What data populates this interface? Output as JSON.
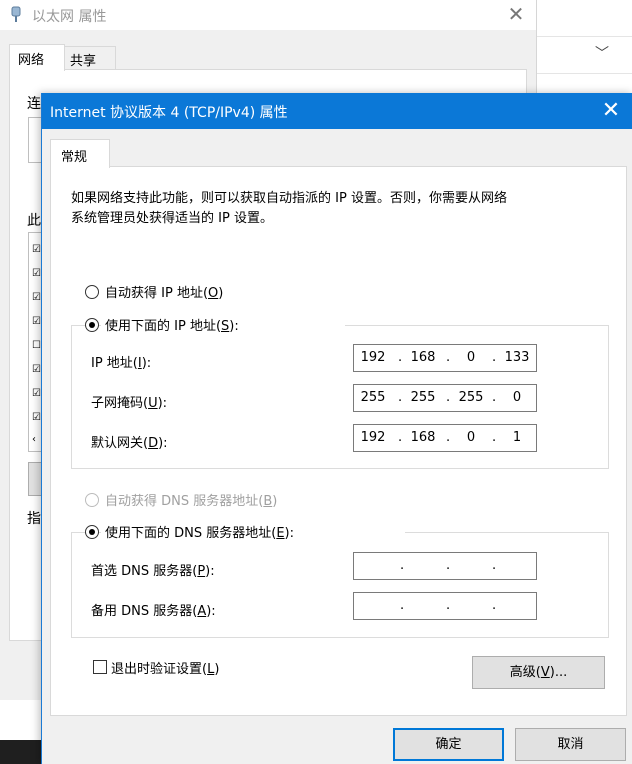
{
  "background_window": {
    "title": "以太网 属性",
    "tabs": [
      "网络",
      "共享"
    ],
    "fragments": [
      "连",
      "此",
      "指"
    ]
  },
  "dialog": {
    "title": "Internet 协议版本 4 (TCP/IPv4) 属性",
    "tab": "常规",
    "description_line1": "如果网络支持此功能，则可以获取自动指派的 IP 设置。否则，你需要从网络",
    "description_line2": "系统管理员处获得适当的 IP 设置。",
    "ip_mode": {
      "auto_label": "自动获得 IP 地址(",
      "auto_key": "O",
      "auto_tail": ")",
      "manual_label": "使用下面的 IP 地址(",
      "manual_key": "S",
      "manual_tail": "):",
      "selected": "manual"
    },
    "ip_fields": [
      {
        "label": "IP 地址(",
        "key": "I",
        "tail": "):",
        "octets": [
          "192",
          "168",
          "0",
          "133"
        ]
      },
      {
        "label": "子网掩码(",
        "key": "U",
        "tail": "):",
        "octets": [
          "255",
          "255",
          "255",
          "0"
        ]
      },
      {
        "label": "默认网关(",
        "key": "D",
        "tail": "):",
        "octets": [
          "192",
          "168",
          "0",
          "1"
        ]
      }
    ],
    "dns_mode": {
      "auto_label": "自动获得 DNS 服务器地址(",
      "auto_key": "B",
      "auto_tail": ")",
      "manual_label": "使用下面的 DNS 服务器地址(",
      "manual_key": "E",
      "manual_tail": "):",
      "selected": "manual",
      "auto_disabled": true
    },
    "dns_fields": [
      {
        "label": "首选 DNS 服务器(",
        "key": "P",
        "tail": "):",
        "octets": [
          "",
          "",
          "",
          ""
        ]
      },
      {
        "label": "备用 DNS 服务器(",
        "key": "A",
        "tail": "):",
        "octets": [
          "",
          "",
          "",
          ""
        ]
      }
    ],
    "validate_on_exit": {
      "label": "退出时验证设置(",
      "key": "L",
      "tail": ")",
      "checked": false
    },
    "advanced_button": {
      "label": "高级(",
      "key": "V",
      "tail": ")..."
    },
    "ok_button": "确定",
    "cancel_button": "取消"
  },
  "colors": {
    "title_bar": "#0b78d7",
    "default_button_border": "#0078d7"
  }
}
